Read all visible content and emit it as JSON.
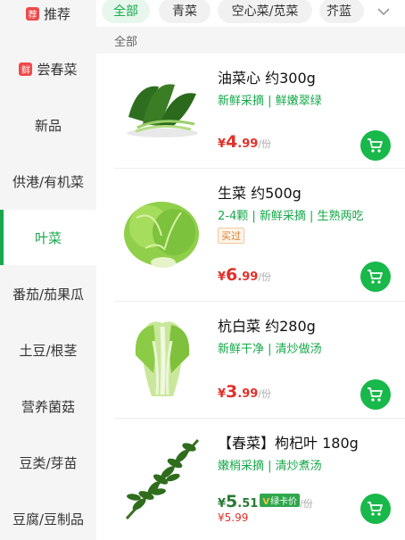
{
  "sidebar": {
    "items": [
      {
        "label": "推荐",
        "badge": "荐"
      },
      {
        "label": "尝春菜",
        "badge": "鲜"
      },
      {
        "label": "新品"
      },
      {
        "label": "供港/有机菜"
      },
      {
        "label": "叶菜",
        "active": true
      },
      {
        "label": "番茄/茄果瓜"
      },
      {
        "label": "土豆/根茎"
      },
      {
        "label": "营养菌菇"
      },
      {
        "label": "豆类/芽苗"
      },
      {
        "label": "豆腐/豆制品"
      }
    ]
  },
  "tabs": [
    "全部",
    "青菜",
    "空心菜/苋菜",
    "芥蓝"
  ],
  "section_title": "全部",
  "products": [
    {
      "name": "油菜心 约300g",
      "desc": "新鲜采摘 | 鲜嫩翠绿",
      "price_symbol": "¥",
      "price_int": "4",
      "price_dec": ".99",
      "unit": "/份"
    },
    {
      "name": "生菜 约500g",
      "desc": "2-4颗 | 新鲜采摘 | 生熟两吃",
      "tag": "买过",
      "price_symbol": "¥",
      "price_int": "6",
      "price_dec": ".99",
      "unit": "/份"
    },
    {
      "name": "杭白菜 约280g",
      "desc": "新鲜干净 | 清炒做汤",
      "price_symbol": "¥",
      "price_int": "3",
      "price_dec": ".99",
      "unit": "/份"
    },
    {
      "name": "【春菜】枸杞叶 180g",
      "desc": "嫩梢采摘 | 清炒煮汤",
      "price_symbol": "¥",
      "price_int": "5",
      "price_dec": ".51",
      "card_label": "绿卡价",
      "card_v": "V",
      "unit": "/份",
      "old_price": "¥5.99"
    }
  ],
  "colors": {
    "accent": "#16a84a",
    "price": "#e0312a",
    "badge": "#ef4a4a",
    "cart": "#18b84a"
  },
  "icons": {
    "expand": "chevron-down-icon",
    "cart": "cart-icon"
  }
}
